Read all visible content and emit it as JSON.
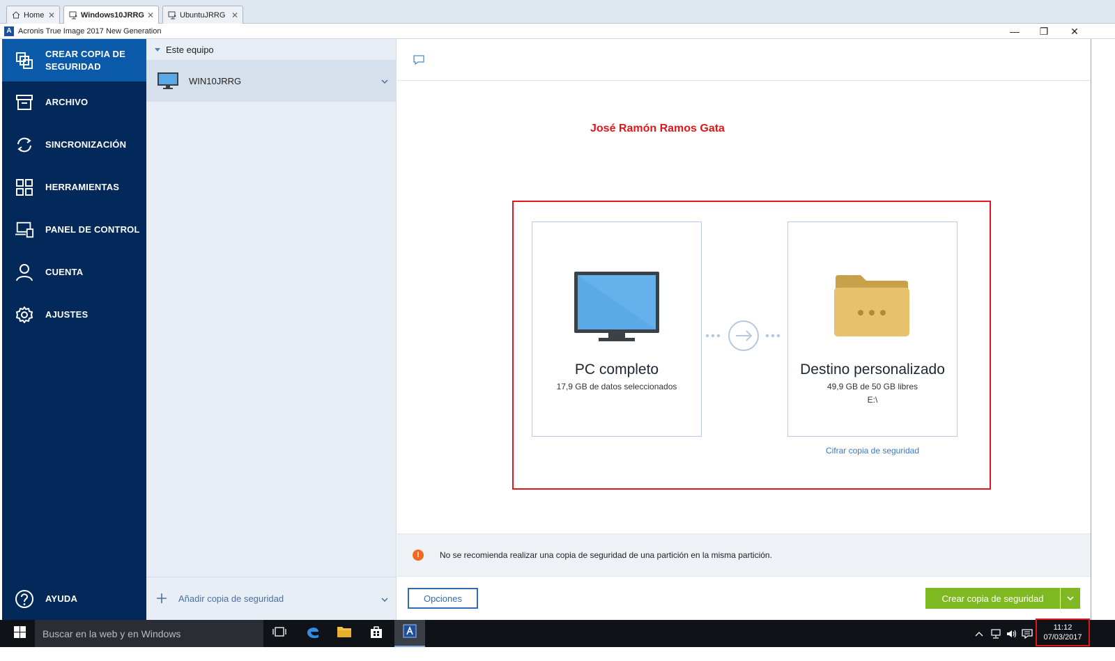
{
  "vm_tabs": [
    {
      "label": "Home",
      "icon": "home-icon"
    },
    {
      "label": "Windows10JRRG",
      "icon": "vm-icon"
    },
    {
      "label": "UbuntuJRRG",
      "icon": "vm-icon"
    }
  ],
  "vm_tab_close": "✕",
  "app": {
    "logo_letter": "A",
    "title": "Acronis True Image 2017 New Generation",
    "minimize": "—",
    "restore": "❐",
    "close": "✕"
  },
  "sidebar": {
    "items": [
      {
        "label_line1": "CREAR COPIA DE",
        "label_line2": "SEGURIDAD",
        "icon": "backup-icon"
      },
      {
        "label": "ARCHIVO",
        "icon": "archive-icon"
      },
      {
        "label": "SINCRONIZACIÓN",
        "icon": "sync-icon"
      },
      {
        "label": "HERRAMIENTAS",
        "icon": "tools-grid-icon"
      },
      {
        "label": "PANEL DE CONTROL",
        "icon": "dashboard-icon"
      },
      {
        "label": "CUENTA",
        "icon": "user-icon"
      },
      {
        "label": "AJUSTES",
        "icon": "gear-icon"
      }
    ],
    "help": {
      "label": "AYUDA",
      "icon": "help-icon"
    }
  },
  "backup_list": {
    "group": "Este equipo",
    "machine": "WIN10JRRG",
    "add_label": "Añadir copia de seguridad"
  },
  "main": {
    "author": "José Ramón Ramos Gata",
    "source": {
      "title": "PC completo",
      "subtitle": "17,9 GB de datos seleccionados"
    },
    "destination": {
      "title": "Destino personalizado",
      "subtitle": "49,9 GB de 50 GB libres",
      "path": "E:\\"
    },
    "encrypt_link": "Cifrar copia de seguridad",
    "warning": {
      "icon_glyph": "!",
      "text": "No se recomienda realizar una copia de seguridad de una partición en la misma partición."
    },
    "options_button": "Opciones",
    "create_button": "Crear copia de seguridad"
  },
  "taskbar": {
    "search_placeholder": "Buscar en la web y en Windows",
    "clock_time": "11:12",
    "clock_date": "07/03/2017"
  },
  "colors": {
    "sidebar_bg": "#03295b",
    "sidebar_active": "#0b5aa9",
    "accent_green": "#7fb921",
    "highlight_red": "#e0161b",
    "link_blue": "#3a78c0"
  }
}
